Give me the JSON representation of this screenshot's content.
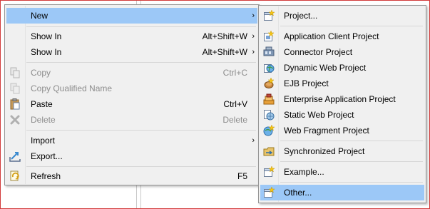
{
  "context_menu": {
    "items": [
      {
        "label": "New",
        "accel": "",
        "submenu": true,
        "highlighted": true,
        "icon": "none",
        "enabled": true
      },
      {
        "label": "Show In",
        "accel": "Alt+Shift+W",
        "submenu": true,
        "icon": "none",
        "enabled": true
      },
      {
        "label": "Show In",
        "accel": "Alt+Shift+W",
        "submenu": true,
        "icon": "none",
        "enabled": true
      },
      {
        "label": "Copy",
        "accel": "Ctrl+C",
        "icon": "copy-icon",
        "enabled": false
      },
      {
        "label": "Copy Qualified Name",
        "accel": "",
        "icon": "copy-qualified-name-icon",
        "enabled": false
      },
      {
        "label": "Paste",
        "accel": "Ctrl+V",
        "icon": "paste-icon",
        "enabled": true
      },
      {
        "label": "Delete",
        "accel": "Delete",
        "icon": "delete-icon",
        "enabled": false
      },
      {
        "label": "Import",
        "accel": "",
        "submenu": true,
        "icon": "none",
        "enabled": true
      },
      {
        "label": "Export...",
        "accel": "",
        "icon": "export-icon",
        "enabled": true
      },
      {
        "label": "Refresh",
        "accel": "F5",
        "icon": "refresh-icon",
        "enabled": true
      }
    ]
  },
  "new_submenu": {
    "items": [
      {
        "label": "Project...",
        "icon": "new-project-icon"
      },
      {
        "label": "Application Client Project",
        "icon": "application-client-project-icon"
      },
      {
        "label": "Connector Project",
        "icon": "connector-project-icon"
      },
      {
        "label": "Dynamic Web Project",
        "icon": "dynamic-web-project-icon"
      },
      {
        "label": "EJB Project",
        "icon": "ejb-project-icon"
      },
      {
        "label": "Enterprise Application Project",
        "icon": "enterprise-application-project-icon"
      },
      {
        "label": "Static Web Project",
        "icon": "static-web-project-icon"
      },
      {
        "label": "Web Fragment Project",
        "icon": "web-fragment-project-icon"
      },
      {
        "label": "Synchronized Project",
        "icon": "synchronized-project-icon"
      },
      {
        "label": "Example...",
        "icon": "example-icon"
      },
      {
        "label": "Other...",
        "icon": "other-wizard-icon",
        "highlighted": true
      }
    ]
  },
  "colors": {
    "menu_bg": "#f0f0f0",
    "highlight": "#9cc8f7",
    "disabled_text": "#8d8d8d",
    "frame_border": "#d23b3b"
  }
}
